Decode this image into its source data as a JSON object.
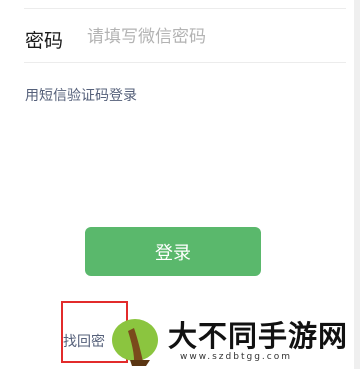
{
  "password": {
    "label": "密码",
    "placeholder": "请填写微信密码",
    "value": ""
  },
  "sms_login_link": "用短信验证码登录",
  "login_button": "登录",
  "find_password_link": "找回密",
  "watermark": {
    "title": "大不同手游网",
    "url": "www.szdbtgg.com"
  },
  "colors": {
    "primary_green": "#5ab86c",
    "link_blue": "#55607a",
    "highlight_red": "#e22b2b"
  }
}
